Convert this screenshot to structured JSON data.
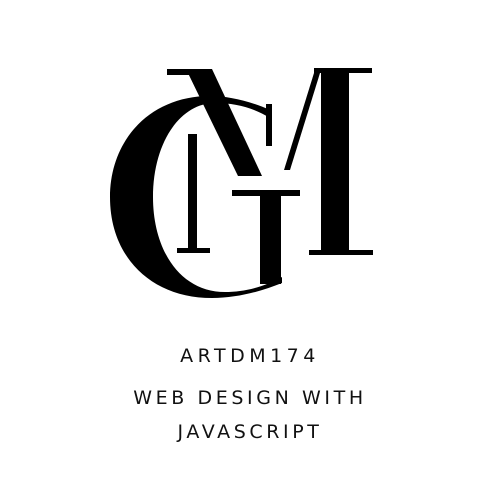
{
  "logo": {
    "monogram_letters": "GM",
    "ink_color": "#000000",
    "background_color": "#ffffff"
  },
  "caption": {
    "course_code": "ARTDM174",
    "course_title_line_1": "WEB DESIGN WITH",
    "course_title_line_2": "JAVASCRIPT"
  }
}
